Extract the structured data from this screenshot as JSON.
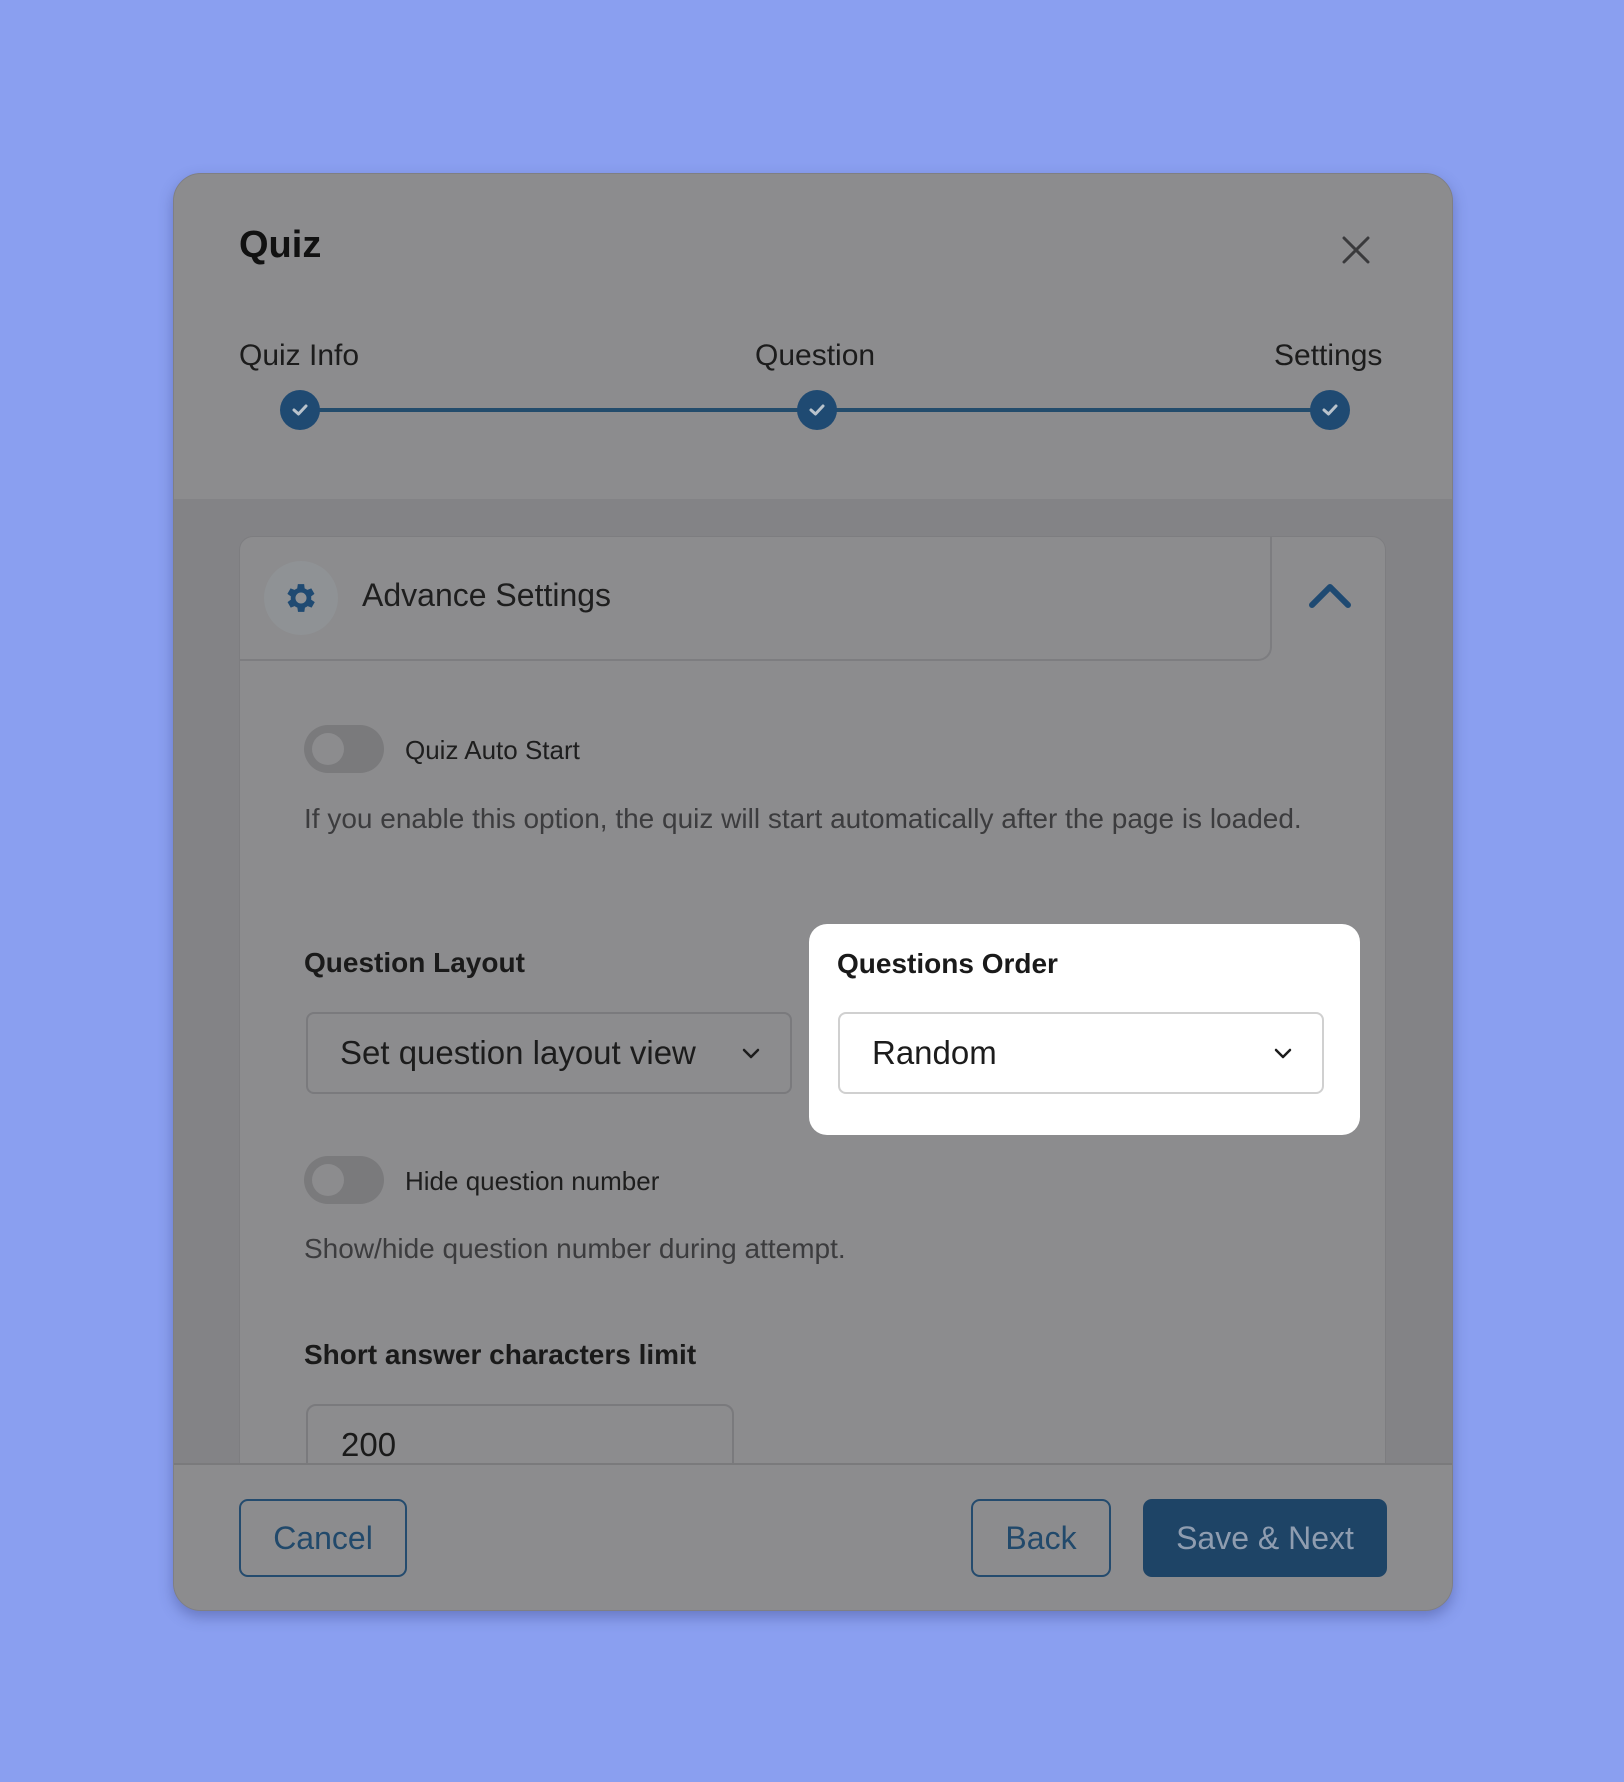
{
  "modal": {
    "title": "Quiz",
    "close_icon": "close-icon"
  },
  "steps": [
    {
      "label": "Quiz Info",
      "status": "completed"
    },
    {
      "label": "Question",
      "status": "completed"
    },
    {
      "label": "Settings",
      "status": "completed"
    }
  ],
  "panel": {
    "title": "Advance Settings",
    "icon": "gear-icon",
    "expanded": true
  },
  "settings": {
    "auto_start": {
      "label": "Quiz Auto Start",
      "enabled": false,
      "help": "If you enable this option, the quiz will start automatically after the page is loaded."
    },
    "question_layout": {
      "label": "Question Layout",
      "value": "Set question layout view"
    },
    "questions_order": {
      "label": "Questions Order",
      "value": "Random"
    },
    "hide_number": {
      "label": "Hide question number",
      "enabled": false,
      "help": "Show/hide question number during attempt."
    },
    "short_answer": {
      "label": "Short answer characters limit",
      "value": "200"
    }
  },
  "footer": {
    "cancel": "Cancel",
    "back": "Back",
    "save_next": "Save & Next"
  },
  "colors": {
    "brand": "#1e4466",
    "page_bg": "#8a9ff0"
  }
}
